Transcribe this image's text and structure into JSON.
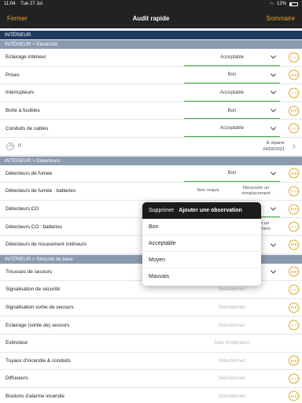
{
  "status": {
    "time": "11:04",
    "date": "Tue 27 Jul",
    "battery": "12%"
  },
  "nav": {
    "close_label": "Fermer",
    "title": "Audit rapide",
    "summary_label": "Sommaire"
  },
  "section_interieur": "INTÉRIEUR",
  "sub_electricite": "INTÉRIEUR > Electricité",
  "electricite_rows": [
    {
      "label": "Eclairage intérieur",
      "value": "Acceptable"
    },
    {
      "label": "Prises",
      "value": "Bon"
    },
    {
      "label": "Interrupteurs",
      "value": "Acceptable"
    },
    {
      "label": "Boîte à fusibles",
      "value": "Bon"
    },
    {
      "label": "Conduits de cables",
      "value": "Acceptable"
    }
  ],
  "repair_row": {
    "label": "R",
    "status": "À réparer",
    "date": "24/03/2021"
  },
  "sub_detecteurs": "INTÉRIEUR > Détecteurs",
  "detecteurs_rows": [
    {
      "label": "Détecteurs de fumée",
      "value": "Bon"
    },
    {
      "label": "Détecteurs de fumée : batteries",
      "option_a": "Non requis",
      "option_b": "Nécessite un remplacement"
    },
    {
      "label": "Détecteurs CO"
    },
    {
      "label": "Détecteurs CO : batteries",
      "partial": "Nécessite un\nremplacement"
    },
    {
      "label": "Détecteurs de mouvement intérieurs"
    }
  ],
  "sub_securite": "INTÉRIEUR > Sécurité de base",
  "securite_rows": [
    {
      "label": "Trousses de secours",
      "value": ""
    },
    {
      "label": "Signalisation de sécurité",
      "value": "Sélectionnez"
    },
    {
      "label": "Signalisation sortie de secours",
      "value": "Sélectionnez"
    },
    {
      "label": "Eclairage (sortie de) secours",
      "value": "Sélectionnez"
    },
    {
      "label": "Extincteur",
      "value": "Date d'expiration"
    },
    {
      "label": "Tuyaux d'incendie & conduits",
      "value": "Sélectionnez"
    },
    {
      "label": "Diffuseurs",
      "value": "Sélectionnez"
    },
    {
      "label": "Boutons d'alarme incendie",
      "value": "Sélectionnez"
    }
  ],
  "popover": {
    "delete_label": "Supprimer",
    "add_observation_label": "Ajouter une observation",
    "options": [
      "Bon",
      "Acceptable",
      "Moyen",
      "Mauvais"
    ]
  },
  "colors": {
    "accent": "#f0a020",
    "section": "#1f3a5f",
    "subsection": "#8a9bb0",
    "valid": "#3aa845"
  }
}
